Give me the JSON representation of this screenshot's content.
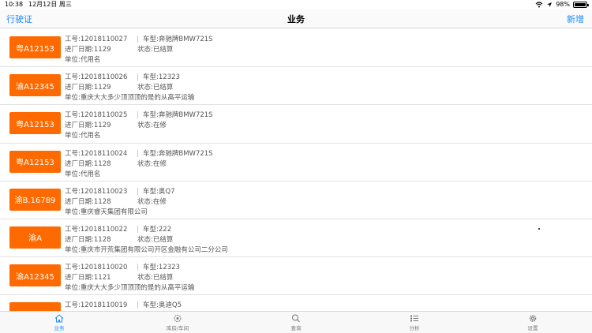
{
  "status": {
    "time": "10:38",
    "date": "12月12日 周三",
    "battery": "98%"
  },
  "nav": {
    "left": "行驶证",
    "title": "业务",
    "right": "新增"
  },
  "labels": {
    "job": "工号:",
    "model": "车型:",
    "date": "进厂日期:",
    "state": "状态:",
    "unit": "单位:"
  },
  "rows": [
    {
      "plate": "粤A12153",
      "job": "12018110027",
      "model": "奔驰牌BMW721S",
      "date": "1129",
      "state": "已结算",
      "unit": "代用名"
    },
    {
      "plate": "渝A12345",
      "job": "12018110026",
      "model": "12323",
      "date": "1129",
      "state": "已结算",
      "unit": "重庆大大多少顶顶顶的是的从高平运输"
    },
    {
      "plate": "粤A12153",
      "job": "12018110025",
      "model": "奔驰牌BMW721S",
      "date": "1129",
      "state": "在修",
      "unit": "代用名"
    },
    {
      "plate": "粤A12153",
      "job": "12018110024",
      "model": "奔驰牌BMW721S",
      "date": "1128",
      "state": "在修",
      "unit": "代用名"
    },
    {
      "plate": "渝B.16789",
      "job": "12018110023",
      "model": "奥Q7",
      "date": "1128",
      "state": "在修",
      "unit": "重庆睿天集团有限公司"
    },
    {
      "plate": "渝A",
      "job": "12018110022",
      "model": "222",
      "date": "1128",
      "state": "已结算",
      "unit": "重庆市开荒集团有限公司开区金融有公司二分公司"
    },
    {
      "plate": "渝A12345",
      "job": "12018110020",
      "model": "12323",
      "date": "1121",
      "state": "已结算",
      "unit": "重庆大大多少顶顶顶的是的从高平运输"
    },
    {
      "plate": "",
      "job": "12018110019",
      "model": "奥迪Q5",
      "date": "",
      "state": "",
      "unit": ""
    }
  ],
  "tabs": [
    {
      "label": "业务",
      "icon": "home-icon",
      "active": true
    },
    {
      "label": "库房/车间",
      "icon": "warehouse-icon",
      "active": false
    },
    {
      "label": "查询",
      "icon": "search-icon",
      "active": false
    },
    {
      "label": "分析",
      "icon": "list-icon",
      "active": false
    },
    {
      "label": "设置",
      "icon": "gear-icon",
      "active": false
    }
  ],
  "colors": {
    "accent": "#1a8cff",
    "plate": "#ff6a00"
  }
}
